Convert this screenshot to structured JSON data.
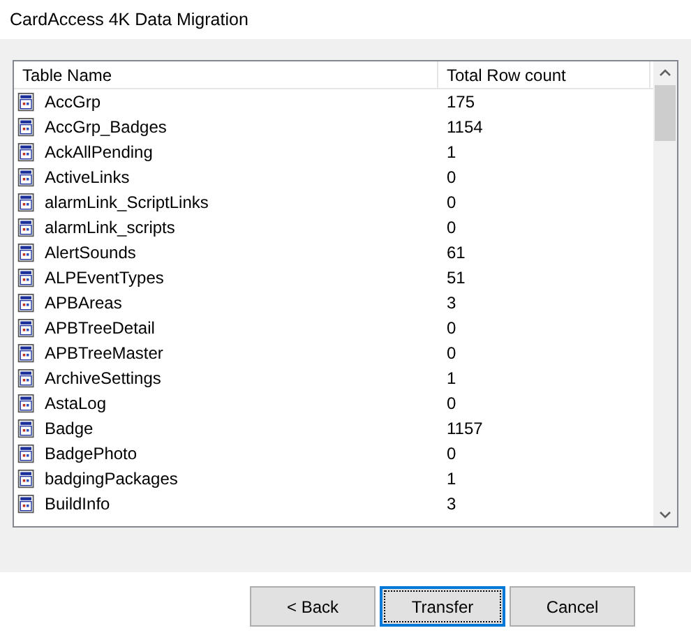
{
  "window": {
    "title": "CardAccess 4K Data Migration"
  },
  "table": {
    "columns": [
      "Table Name",
      "Total Row count"
    ],
    "rows": [
      {
        "name": "AccGrp",
        "count": "175"
      },
      {
        "name": "AccGrp_Badges",
        "count": "1154"
      },
      {
        "name": "AckAllPending",
        "count": "1"
      },
      {
        "name": "ActiveLinks",
        "count": "0"
      },
      {
        "name": "alarmLink_ScriptLinks",
        "count": "0"
      },
      {
        "name": "alarmLink_scripts",
        "count": "0"
      },
      {
        "name": "AlertSounds",
        "count": "61"
      },
      {
        "name": "ALPEventTypes",
        "count": "51"
      },
      {
        "name": "APBAreas",
        "count": "3"
      },
      {
        "name": "APBTreeDetail",
        "count": "0"
      },
      {
        "name": "APBTreeMaster",
        "count": "0"
      },
      {
        "name": "ArchiveSettings",
        "count": "1"
      },
      {
        "name": "AstaLog",
        "count": "0"
      },
      {
        "name": "Badge",
        "count": "1157"
      },
      {
        "name": "BadgePhoto",
        "count": "0"
      },
      {
        "name": "badgingPackages",
        "count": "1"
      },
      {
        "name": "BuildInfo",
        "count": "3"
      }
    ]
  },
  "buttons": [
    {
      "label": "< Back",
      "focused": false
    },
    {
      "label": "Transfer",
      "focused": true
    },
    {
      "label": "Cancel",
      "focused": false
    }
  ]
}
